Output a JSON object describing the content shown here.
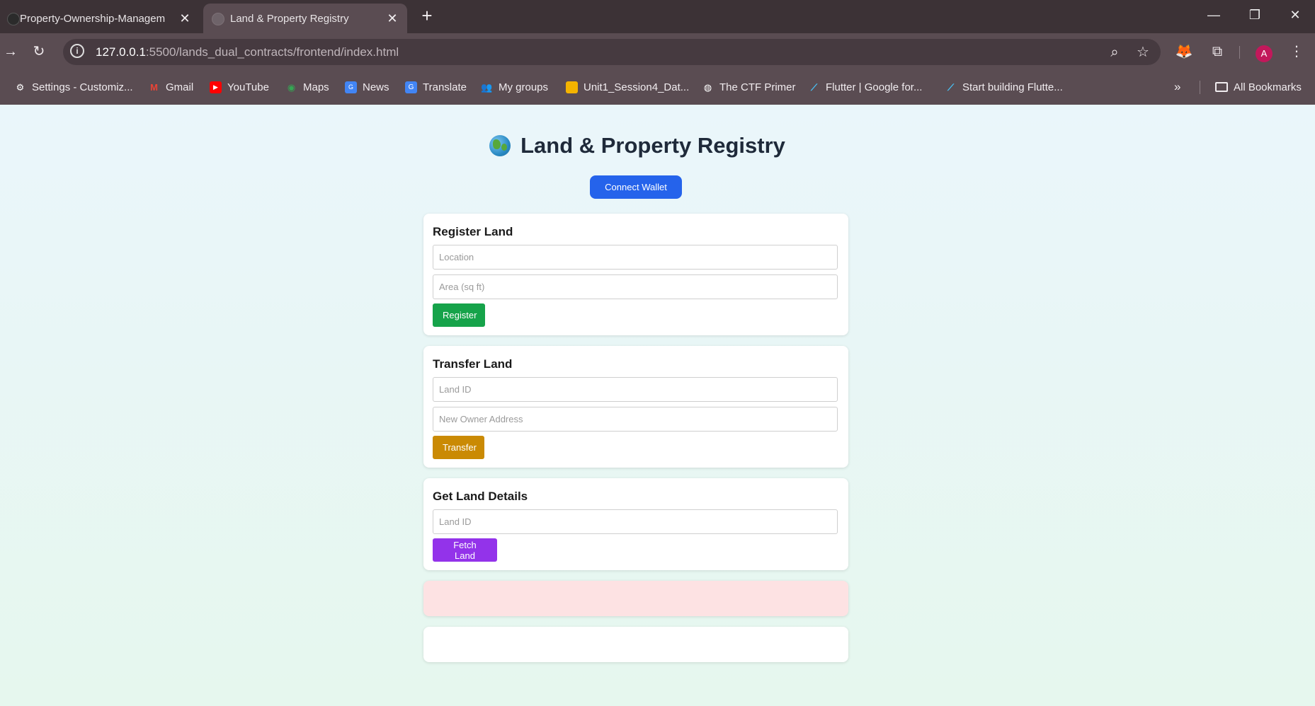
{
  "browser": {
    "tabs": [
      {
        "title": "Property-Ownership-Management",
        "active": false
      },
      {
        "title": "Land & Property Registry",
        "active": true
      }
    ],
    "url_host": "127.0.0.1",
    "url_rest": ":5500/lands_dual_contracts/frontend/index.html",
    "profile_initial": "A",
    "bookmarks": [
      {
        "label": "Settings - Customiz...",
        "icon": "gear-icon"
      },
      {
        "label": "Gmail",
        "icon": "gmail-icon"
      },
      {
        "label": "YouTube",
        "icon": "youtube-icon"
      },
      {
        "label": "Maps",
        "icon": "maps-icon"
      },
      {
        "label": "News",
        "icon": "news-icon"
      },
      {
        "label": "Translate",
        "icon": "translate-icon"
      },
      {
        "label": "My groups",
        "icon": "groups-icon"
      },
      {
        "label": "Unit1_Session4_Dat...",
        "icon": "slides-icon"
      },
      {
        "label": "The CTF Primer",
        "icon": "globe-icon"
      },
      {
        "label": "Flutter | Google for...",
        "icon": "flutter-icon"
      },
      {
        "label": "Start building Flutte...",
        "icon": "flutter-icon"
      }
    ],
    "all_bookmarks": "All Bookmarks"
  },
  "page": {
    "title": "Land & Property Registry",
    "connect_label": "Connect Wallet",
    "register": {
      "heading": "Register Land",
      "location_placeholder": "Location",
      "area_placeholder": "Area (sq ft)",
      "button": "Register"
    },
    "transfer": {
      "heading": "Transfer Land",
      "land_id_placeholder": "Land ID",
      "new_owner_placeholder": "New Owner Address",
      "button": "Transfer"
    },
    "get": {
      "heading": "Get Land Details",
      "land_id_placeholder": "Land ID",
      "button": "Fetch Land"
    },
    "colors": {
      "connect": "#2563eb",
      "register": "#16a34a",
      "transfer": "#ca8a04",
      "fetch": "#9333ea",
      "error_box": "#fde2e3"
    }
  }
}
